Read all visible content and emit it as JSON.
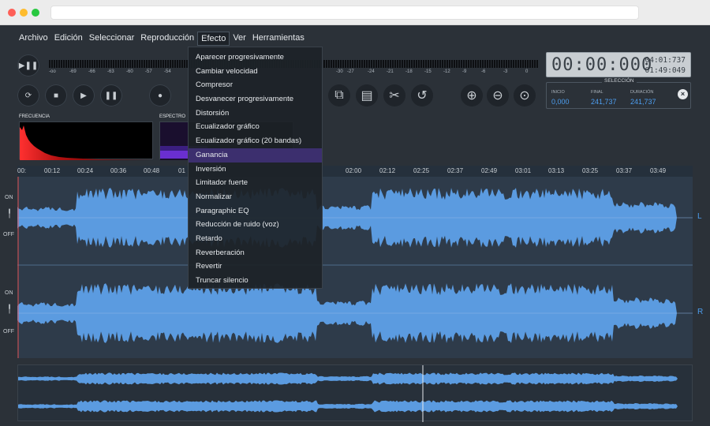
{
  "menubar": [
    "Archivo",
    "Edición",
    "Seleccionar",
    "Reproducción",
    "Efecto",
    "Ver",
    "Herramientas"
  ],
  "active_menu": "Efecto",
  "dropdown_items": [
    "Aparecer progresivamente",
    "Cambiar velocidad",
    "Compresor",
    "Desvanecer progresivamente",
    "Distorsión",
    "Ecualizador gráfico",
    "Ecualizador gráfico (20 bandas)",
    "Ganancia",
    "Inversión",
    "Limitador fuerte",
    "Normalizar",
    "Paragraphic EQ",
    "Reducción de ruido (voz)",
    "Retardo",
    "Reverberación",
    "Revertir",
    "Truncar silencio"
  ],
  "hover_item": "Ganancia",
  "meter_scale": [
    "-oo",
    "-69",
    "-66",
    "-63",
    "-60",
    "-57",
    "-54",
    "-30",
    "-27",
    "-24",
    "-21",
    "-18",
    "-15",
    "-12",
    "-9",
    "-6",
    "-3",
    "0"
  ],
  "time": {
    "main": "00:00:000",
    "total": "04:01:737",
    "secondary": "01:49:049"
  },
  "selection": {
    "title": "SELECCIÓN",
    "start_label": "INICIO",
    "start": "0,000",
    "end_label": "FINAL",
    "end": "241,737",
    "dur_label": "DURACIÓN",
    "dur": "241,737"
  },
  "panels": {
    "freq": "FRECUENCIA",
    "spectrum": "ESPECTRO"
  },
  "ruler": [
    "00:",
    "00:12",
    "00:24",
    "00:36",
    "00:48",
    "01",
    "02:00",
    "02:12",
    "02:25",
    "02:37",
    "02:49",
    "03:01",
    "03:13",
    "03:25",
    "03:37",
    "03:49"
  ],
  "channels": {
    "on": "ON",
    "off": "OFF",
    "left": "L",
    "right": "R"
  },
  "icons": [
    "play-pause-icon",
    "loop-icon",
    "stop-icon",
    "play-icon",
    "pause-icon",
    "record-icon",
    "copy-icon",
    "paste-icon",
    "cut-icon",
    "undo-icon",
    "zoom-in-icon",
    "zoom-out-icon",
    "zoom-fit-icon",
    "close-icon"
  ],
  "colors": {
    "accent": "#4d9ef0",
    "waveform": "#5b9be0",
    "hover": "#3c2f6e"
  }
}
